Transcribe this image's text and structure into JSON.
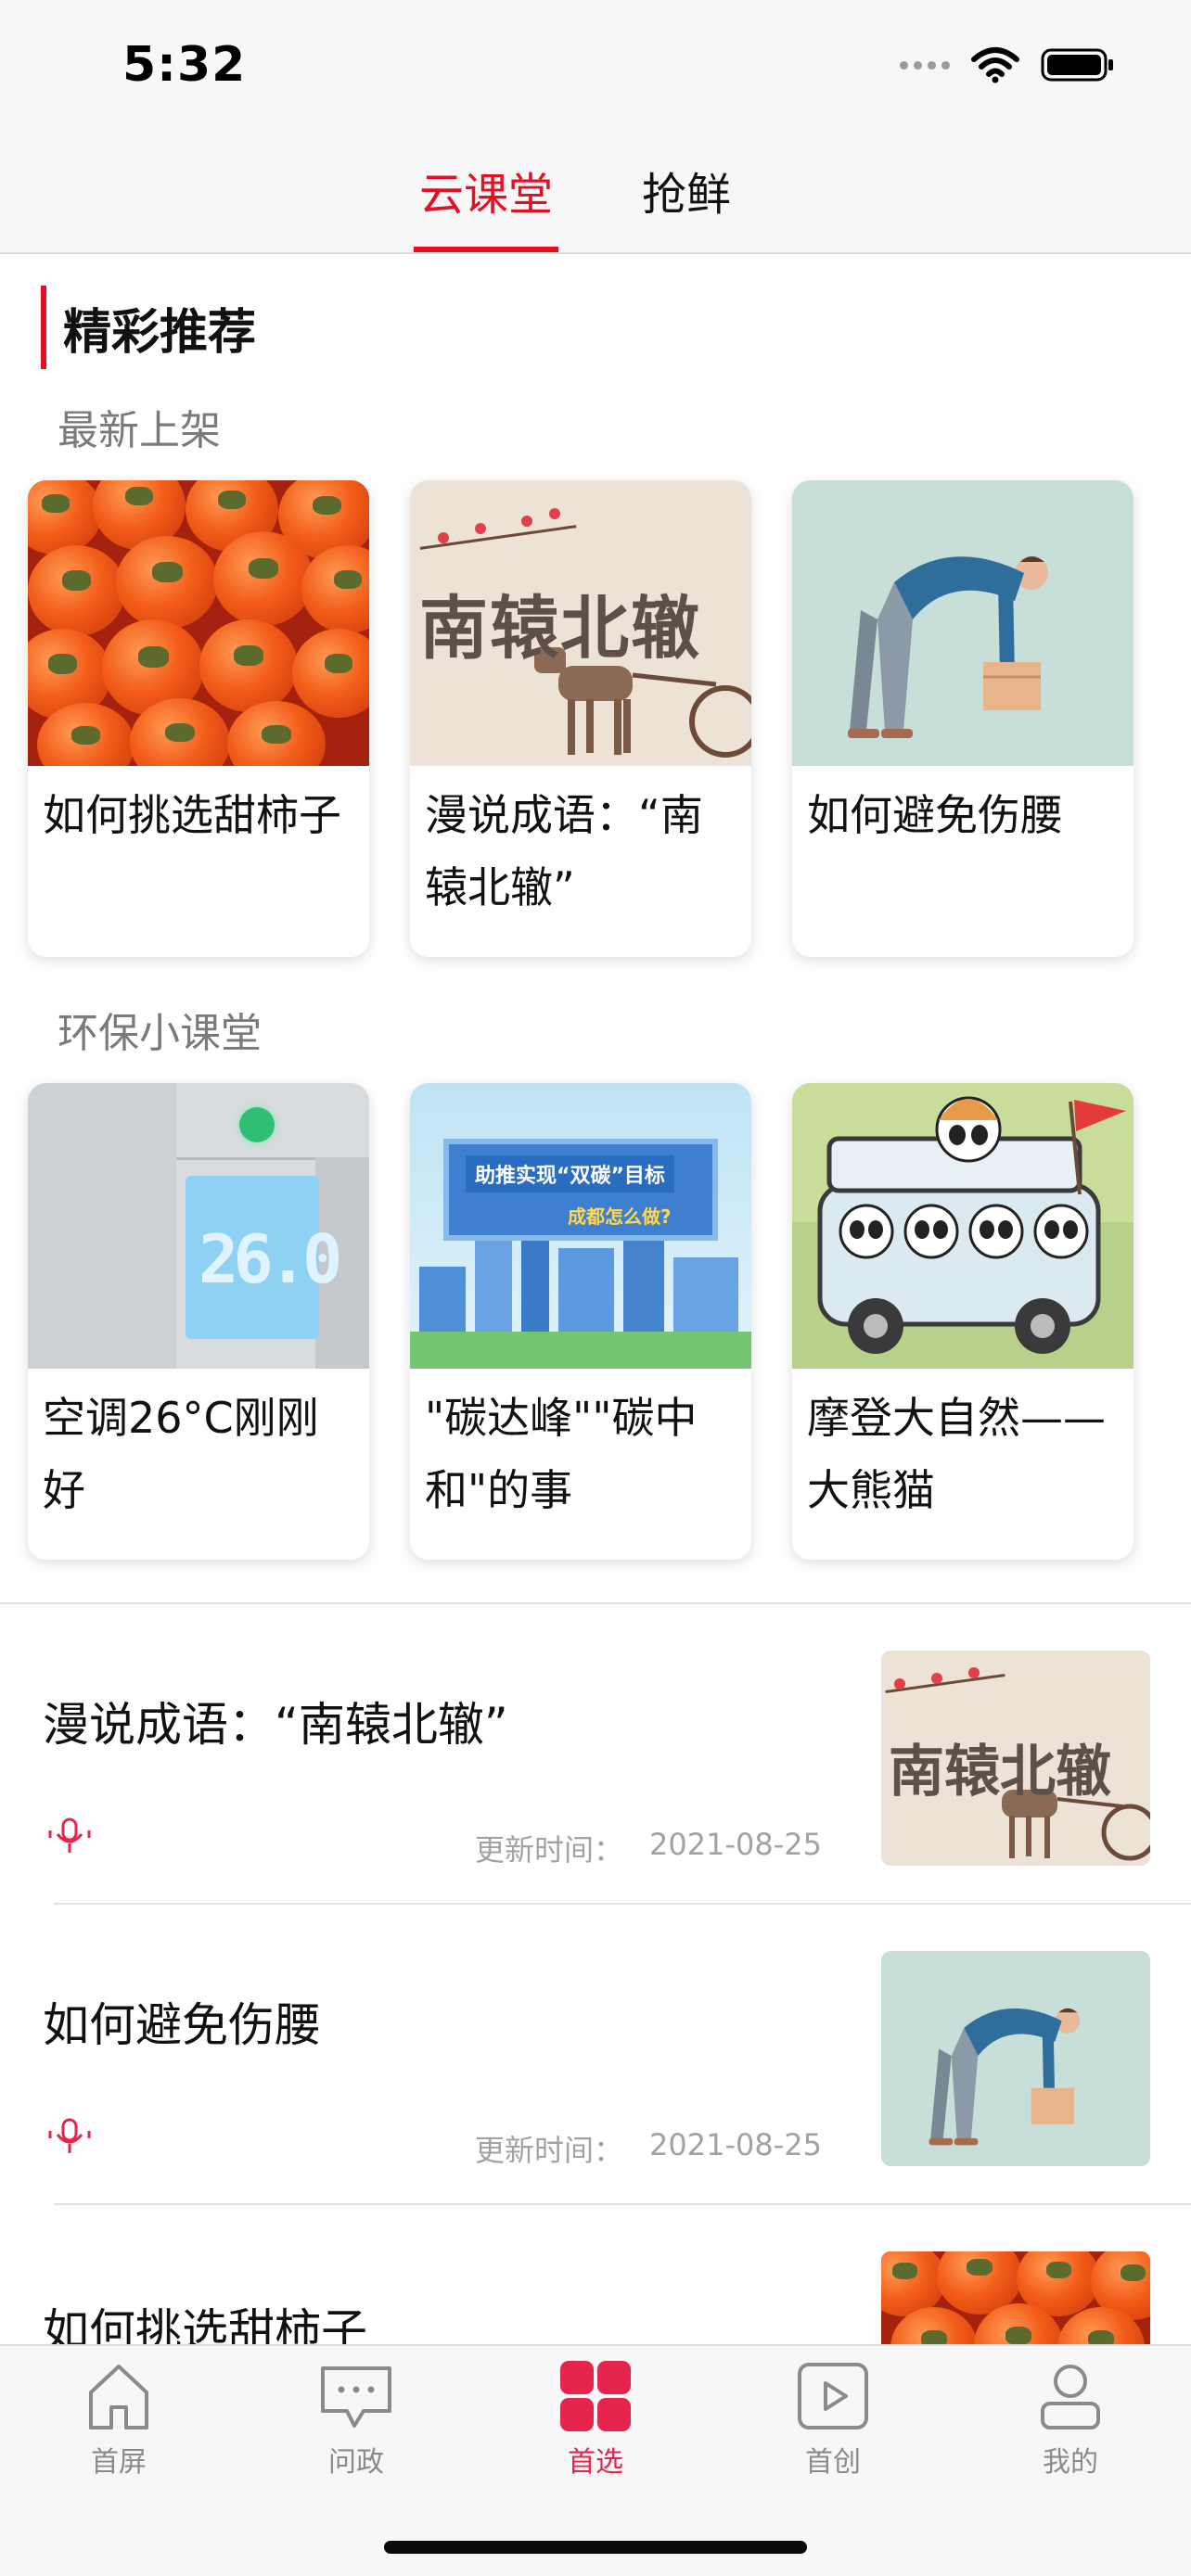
{
  "status_bar": {
    "time": "5:32"
  },
  "top_tabs": [
    {
      "label": "云课堂",
      "active": true
    },
    {
      "label": "抢鲜",
      "active": false
    }
  ],
  "featured": {
    "heading": "精彩推荐",
    "groups": [
      {
        "title": "最新上架",
        "cards": [
          {
            "title": "如何挑选甜柿子",
            "thumb": "persimmons"
          },
          {
            "title": "漫说成语：“南辕北辙”",
            "thumb": "idiom-nanyuanbeizhe",
            "thumb_text": "南辕北辙"
          },
          {
            "title": "如何避免伤腰",
            "thumb": "man-bending-lifting-box"
          }
        ]
      },
      {
        "title": "环保小课堂",
        "cards": [
          {
            "title": "空调26°C刚刚好",
            "thumb": "air-conditioner-panel",
            "thumb_text": "26.0"
          },
          {
            "title": "\"碳达峰\"\"碳中和\"的事",
            "thumb": "city-carbon-sign",
            "thumb_text_1": "助推实现“双碳”目标",
            "thumb_text_2": "成都怎么做?"
          },
          {
            "title": "摩登大自然——大熊猫",
            "thumb": "pandas-in-bus"
          }
        ]
      }
    ]
  },
  "list": {
    "time_label": "更新时间：",
    "items": [
      {
        "title": "漫说成语：“南辕北辙”",
        "updated": "2021-08-25",
        "thumb": "idiom-nanyuanbeizhe",
        "thumb_text": "南辕北辙"
      },
      {
        "title": "如何避免伤腰",
        "updated": "2021-08-25",
        "thumb": "man-bending-lifting-box"
      },
      {
        "title": "如何挑选甜柿子",
        "updated": "",
        "thumb": "persimmons"
      }
    ]
  },
  "bottom_nav": [
    {
      "label": "首屏",
      "icon": "home-icon",
      "active": false
    },
    {
      "label": "问政",
      "icon": "chat-bubble-icon",
      "active": false
    },
    {
      "label": "首选",
      "icon": "grid-icon",
      "active": true
    },
    {
      "label": "首创",
      "icon": "play-video-icon",
      "active": false
    },
    {
      "label": "我的",
      "icon": "profile-icon",
      "active": false
    }
  ],
  "colors": {
    "accent": "#e50f23",
    "nav_active": "#e5254b",
    "muted": "#8a8a8a"
  }
}
